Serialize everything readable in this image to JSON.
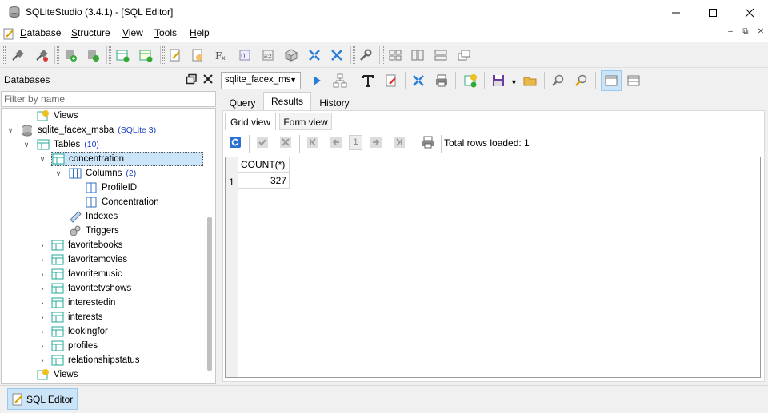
{
  "window": {
    "title": "SQLiteStudio (3.4.1) - [SQL Editor]",
    "minimize_icon": "minimize-icon",
    "maximize_icon": "maximize-icon",
    "close_icon": "close-icon"
  },
  "menu": {
    "items": [
      {
        "label": "Database",
        "underline": "D",
        "rest": "atabase"
      },
      {
        "label": "Structure",
        "underline": "S",
        "rest": "tructure"
      },
      {
        "label": "View",
        "underline": "V",
        "rest": "iew"
      },
      {
        "label": "Tools",
        "underline": "T",
        "rest": "ools"
      },
      {
        "label": "Help",
        "underline": "H",
        "rest": "elp"
      }
    ]
  },
  "databases_panel": {
    "title": "Databases",
    "filter_placeholder": "Filter by name",
    "tree": {
      "views_top": "Views",
      "database": {
        "name": "sqlite_facex_msba",
        "badge": "(SQLite 3)"
      },
      "tables": {
        "label": "Tables",
        "count": "(10)"
      },
      "selected_table": "concentration",
      "columns": {
        "label": "Columns",
        "count": "(2)"
      },
      "column_items": [
        "ProfileID",
        "Concentration"
      ],
      "indexes": "Indexes",
      "triggers": "Triggers",
      "other_tables": [
        "favoritebooks",
        "favoritemovies",
        "favoritemusic",
        "favoritetvshows",
        "interestedin",
        "interests",
        "lookingfor",
        "profiles",
        "relationshipstatus"
      ],
      "views_bottom": "Views"
    }
  },
  "editor": {
    "db_select": "sqlite_facex_ms",
    "tabs": [
      "Query",
      "Results",
      "History"
    ],
    "active_tab": "Results",
    "subtabs": [
      "Grid view",
      "Form view"
    ],
    "active_subtab": "Grid view",
    "page_number": "1",
    "total_rows_label": "Total rows loaded: 1",
    "grid": {
      "columns": [
        "COUNT(*)"
      ],
      "rows": [
        {
          "row_number": "1",
          "values": [
            "327"
          ]
        }
      ]
    }
  },
  "taskbar": {
    "items": [
      "SQL Editor"
    ]
  }
}
